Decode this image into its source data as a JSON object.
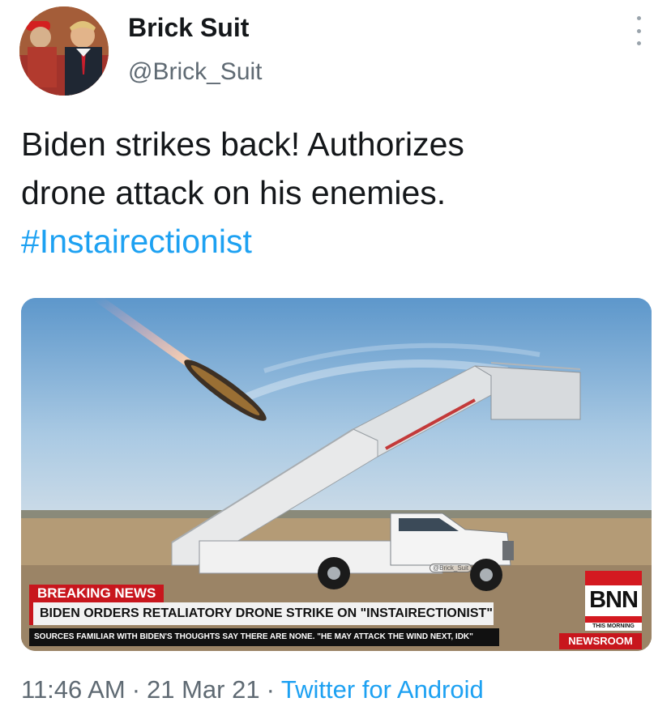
{
  "author": {
    "name": "Brick Suit",
    "handle": "@Brick_Suit",
    "avatar_icon": "profile-photo"
  },
  "menu_icon": "more-vertical-icon",
  "tweet": {
    "line1": "Biden strikes back! Authorizes",
    "line2": "drone attack on his enemies.",
    "hashtag": "#Instairectionist"
  },
  "media": {
    "breaking_label": "BREAKING NEWS",
    "headline": "BIDEN ORDERS RETALIATORY DRONE STRIKE ON \"INSTAIRECTIONIST\"",
    "ticker": "SOURCES FAMILIAR WITH BIDEN'S THOUGHTS SAY THERE ARE NONE. \"HE MAY ATTACK THE WIND NEXT, IDK\"",
    "network": "BNN",
    "network_sub": "THIS MORNING",
    "program": "NEWSROOM",
    "watermark": "@Brick_Suit"
  },
  "meta": {
    "time": "11:46 AM",
    "date": "21 Mar 21",
    "client": "Twitter for Android",
    "separator": "·"
  },
  "colors": {
    "link": "#1da1f2",
    "secondary_text": "#5f6a73",
    "breaking_red": "#c8161d"
  }
}
